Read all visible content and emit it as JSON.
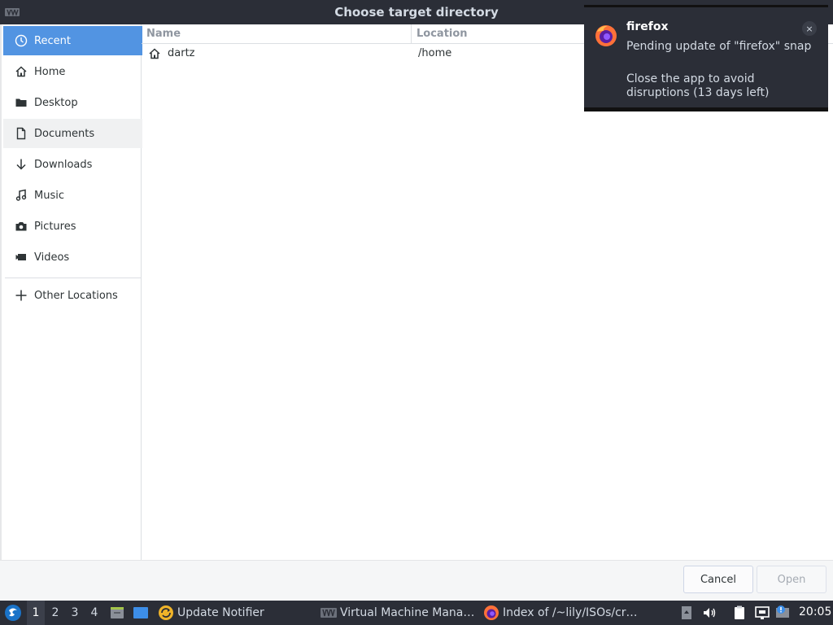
{
  "window": {
    "title": "Choose target directory"
  },
  "sidebar": {
    "items": [
      {
        "label": "Recent",
        "icon": "clock-icon"
      },
      {
        "label": "Home",
        "icon": "home-icon"
      },
      {
        "label": "Desktop",
        "icon": "folder-icon"
      },
      {
        "label": "Documents",
        "icon": "document-icon"
      },
      {
        "label": "Downloads",
        "icon": "download-arrow-icon"
      },
      {
        "label": "Music",
        "icon": "music-note-icon"
      },
      {
        "label": "Pictures",
        "icon": "camera-icon"
      },
      {
        "label": "Videos",
        "icon": "video-icon"
      },
      {
        "label": "Other Locations",
        "icon": "plus-icon"
      }
    ]
  },
  "filelist": {
    "columns": {
      "name": "Name",
      "location": "Location"
    },
    "rows": [
      {
        "name": "dartz",
        "location": "/home",
        "icon": "home-icon"
      }
    ]
  },
  "actions": {
    "cancel": "Cancel",
    "open": "Open"
  },
  "notification": {
    "app": "firefox",
    "body_line1": "Pending update of \"firefox\" snap",
    "body_line2": "Close the app to avoid disruptions (13 days left)",
    "close": "×"
  },
  "taskbar": {
    "workspaces": [
      "1",
      "2",
      "3",
      "4"
    ],
    "active_workspace": "1",
    "tasks": [
      {
        "label": "Update Notifier",
        "icon": "update-notifier-icon"
      },
      {
        "label": "Virtual Machine Mana…",
        "icon": "virt-manager-icon"
      },
      {
        "label": "Index of /~lily/ISOs/cr…",
        "icon": "firefox-icon"
      }
    ],
    "clock": "20:05"
  },
  "colors": {
    "accent": "#5294e2",
    "panel": "#2b2e37"
  }
}
